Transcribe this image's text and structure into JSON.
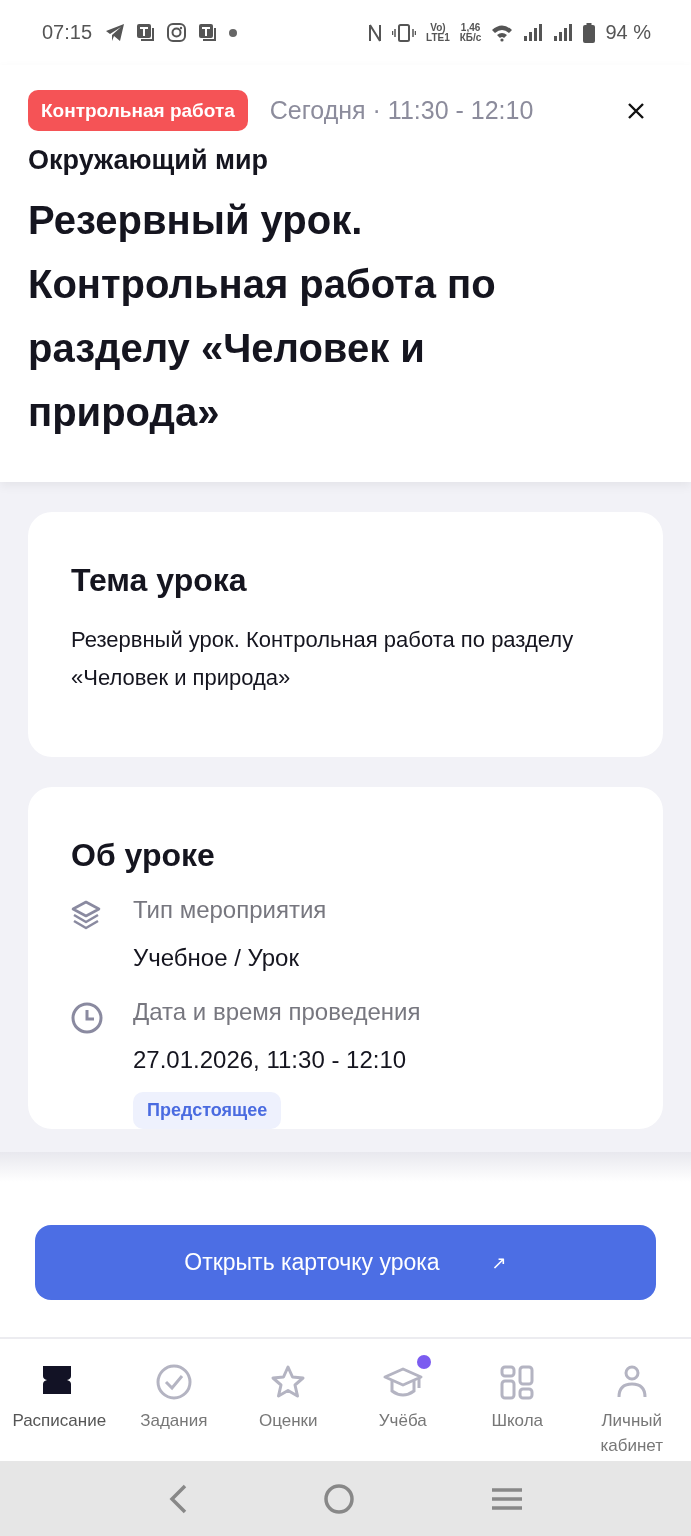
{
  "status_bar": {
    "time": "07:15",
    "volte": "Vo)",
    "network": "LTE1",
    "speed_value": "1,46",
    "speed_unit": "КБ/с",
    "battery": "94 %"
  },
  "header": {
    "tag": "Контрольная работа",
    "when": "Сегодня · 11:30 - 12:10",
    "subject": "Окружающий мир",
    "title": "Резервный урок. Контрольная работа по разделу «Человек и природа»"
  },
  "topic_card": {
    "heading": "Тема урока",
    "text": "Резервный урок. Контрольная работа по разделу «Человек и природа»"
  },
  "about_card": {
    "heading": "Об уроке",
    "rows": [
      {
        "label": "Тип мероприятия",
        "value": "Учебное / Урок"
      },
      {
        "label": "Дата и время проведения",
        "value": "27.01.2026, 11:30 - 12:10",
        "badge": "Предстоящее"
      }
    ]
  },
  "action_button": {
    "label": "Открыть карточку урока",
    "icon": "↗"
  },
  "bottom_nav": [
    {
      "label": "Расписание",
      "selected": true,
      "dot": false
    },
    {
      "label": "Задания",
      "selected": false,
      "dot": false
    },
    {
      "label": "Оценки",
      "selected": false,
      "dot": false
    },
    {
      "label": "Учёба",
      "selected": false,
      "dot": true
    },
    {
      "label": "Школа",
      "selected": false,
      "dot": false
    },
    {
      "label": "Личный кабинет",
      "selected": false,
      "dot": false
    }
  ]
}
